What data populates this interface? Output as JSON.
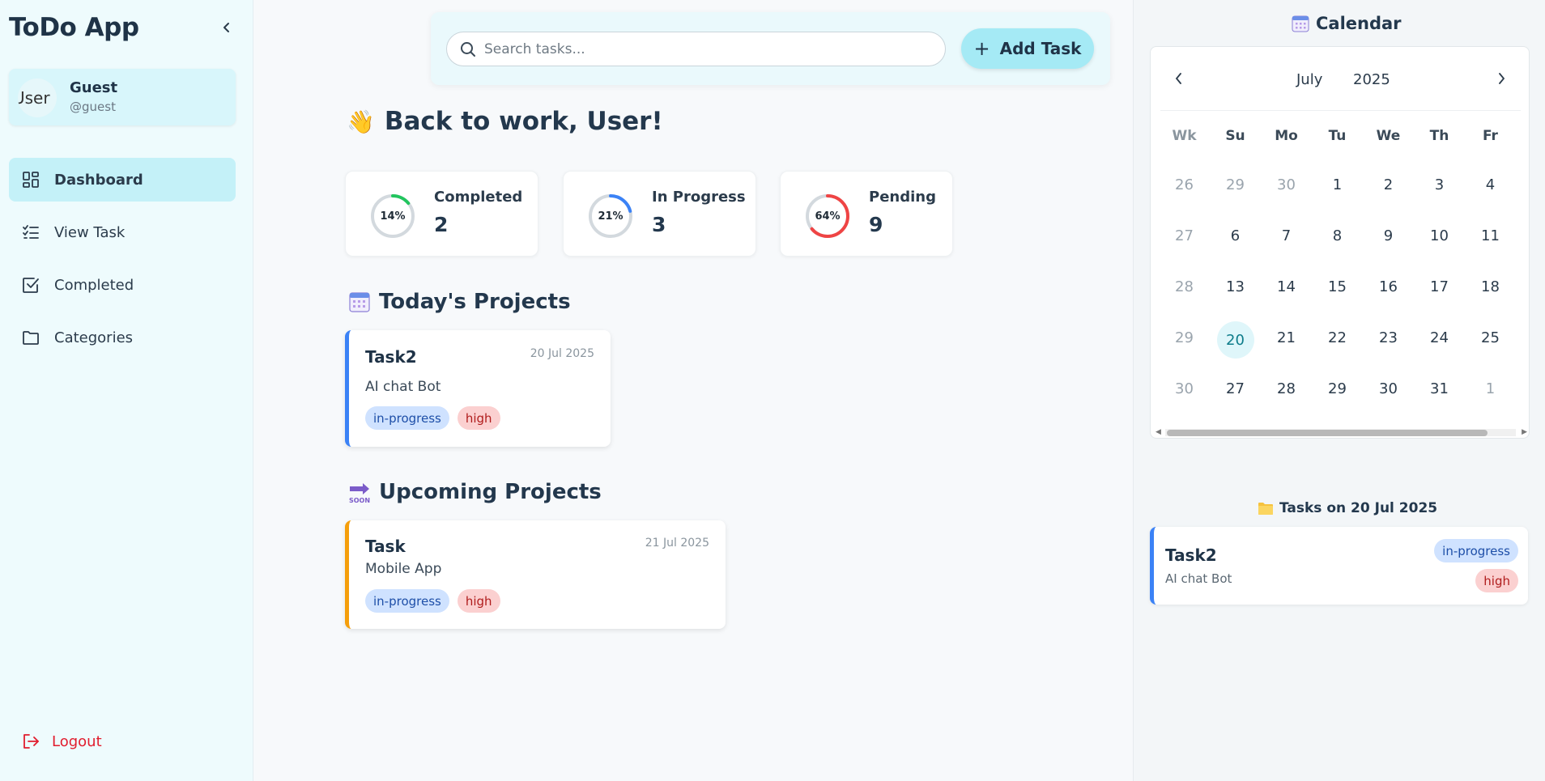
{
  "app": {
    "title": "ToDo App"
  },
  "user": {
    "name": "Guest",
    "handle": "@guest",
    "avatar_alt": "User"
  },
  "nav": {
    "items": [
      {
        "label": "Dashboard",
        "icon": "dashboard-icon",
        "active": true
      },
      {
        "label": "View Task",
        "icon": "list-check-icon"
      },
      {
        "label": "Completed",
        "icon": "checkbox-icon"
      },
      {
        "label": "Categories",
        "icon": "folder-icon"
      }
    ],
    "logout": "Logout"
  },
  "search": {
    "placeholder": "Search tasks..."
  },
  "toolbar": {
    "add_task_label": "Add Task"
  },
  "greeting": {
    "emoji": "👋",
    "text": "Back to work, User!"
  },
  "stats": [
    {
      "label": "Completed",
      "count": "2",
      "percent_label": "14%",
      "percent": 14,
      "color": "#22c55e"
    },
    {
      "label": "In Progress",
      "count": "3",
      "percent_label": "21%",
      "percent": 21,
      "color": "#3b82f6"
    },
    {
      "label": "Pending",
      "count": "9",
      "percent_label": "64%",
      "percent": 64,
      "color": "#ef4444"
    }
  ],
  "today": {
    "title": "Today's Projects",
    "projects": [
      {
        "title": "Task2",
        "date": "20 Jul 2025",
        "description": "AI chat Bot",
        "status": "in-progress",
        "priority": "high",
        "accent": "#3b82f6"
      }
    ]
  },
  "upcoming": {
    "title": "Upcoming Projects",
    "projects": [
      {
        "title": "Task",
        "date": "21 Jul 2025",
        "description": "Mobile App",
        "status": "in-progress",
        "priority": "high",
        "accent": "#f59e0b"
      }
    ]
  },
  "calendar": {
    "title": "Calendar",
    "month": "July",
    "year": "2025",
    "headers": [
      "Wk",
      "Su",
      "Mo",
      "Tu",
      "We",
      "Th",
      "Fr"
    ],
    "weeks": [
      [
        "26",
        "29",
        "30",
        "1",
        "2",
        "3",
        "4"
      ],
      [
        "27",
        "6",
        "7",
        "8",
        "9",
        "10",
        "11"
      ],
      [
        "28",
        "13",
        "14",
        "15",
        "16",
        "17",
        "18"
      ],
      [
        "29",
        "20",
        "21",
        "22",
        "23",
        "24",
        "25"
      ],
      [
        "30",
        "27",
        "28",
        "29",
        "30",
        "31",
        "1"
      ]
    ],
    "selected_day": "20"
  },
  "day_tasks": {
    "title": "Tasks on 20 Jul 2025",
    "items": [
      {
        "title": "Task2",
        "description": "AI chat Bot",
        "status": "in-progress",
        "priority": "high"
      }
    ]
  },
  "colors": {
    "accent": "#a5eaf5",
    "sidebar_bg": "#eefbfd",
    "danger": "#e11d2e"
  }
}
